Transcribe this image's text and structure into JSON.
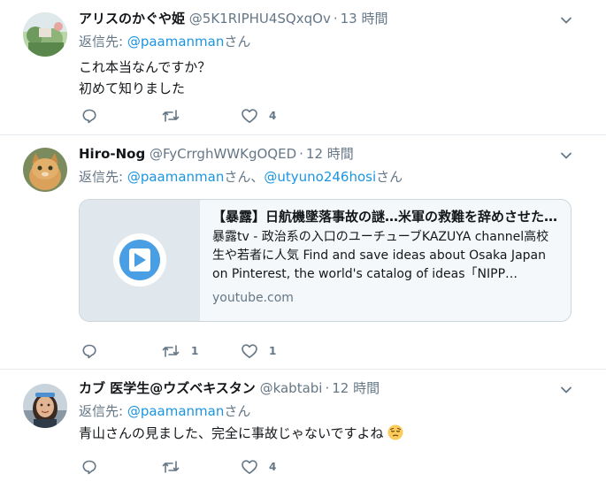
{
  "tweets": [
    {
      "name": "アリスのかぐや姫",
      "handle": "@5K1RIPHU4SQxqOv",
      "time": "13 時間",
      "reply_prefix": "返信先: ",
      "reply_to": "@paamanman",
      "reply_suffix": "さん",
      "text_line1": "これ本当なんですか？",
      "text_line2": "初めて知りました",
      "reply_count": "",
      "retweet_count": "",
      "like_count": "4"
    },
    {
      "name": "Hiro-Nog",
      "handle": "@FyCrrghWWKgOQED",
      "time": "12 時間",
      "reply_prefix": "返信先: ",
      "reply_to": "@paamanman",
      "reply_mid": "さん、",
      "reply_to2": "@utyuno246hosi",
      "reply_suffix": "さん",
      "card": {
        "title": "【暴露】日航機墜落事故の謎…米軍の救難を辞めさせた…",
        "description": "暴露tv - 政治系の入口のユーチューブKAZUYA channel高校生や若者に人気 Find and save ideas about Osaka Japan on Pinterest, the world's catalog of ideas「NIPP…",
        "domain": "youtube.com"
      },
      "reply_count": "",
      "retweet_count": "1",
      "like_count": "1"
    },
    {
      "name": "カブ 医学生@ウズベキスタン",
      "handle": "@kabtabi",
      "time": "12 時間",
      "reply_prefix": "返信先: ",
      "reply_to": "@paamanman",
      "reply_suffix": "さん",
      "text_line1": "青山さんの見ました、完全に事故じゃないですよね",
      "reply_count": "",
      "retweet_count": "",
      "like_count": "4"
    }
  ],
  "icons": {
    "reply": "reply-icon",
    "retweet": "retweet-icon",
    "like": "heart-icon",
    "more": "chevron-down-icon",
    "play": "play-icon",
    "emoji": "pensive-face-icon"
  },
  "colors": {
    "link": "#1b95e0",
    "secondary": "#657786",
    "play_bg": "#4a9ee3"
  }
}
